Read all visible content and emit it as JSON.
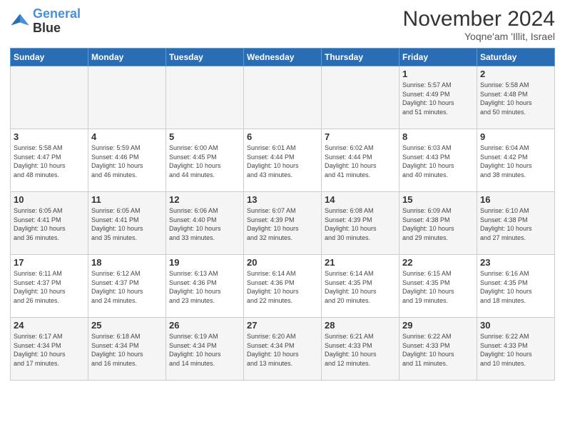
{
  "logo": {
    "line1": "General",
    "line2": "Blue"
  },
  "title": "November 2024",
  "location": "Yoqne'am 'Illit, Israel",
  "days_of_week": [
    "Sunday",
    "Monday",
    "Tuesday",
    "Wednesday",
    "Thursday",
    "Friday",
    "Saturday"
  ],
  "weeks": [
    [
      {
        "day": "",
        "info": ""
      },
      {
        "day": "",
        "info": ""
      },
      {
        "day": "",
        "info": ""
      },
      {
        "day": "",
        "info": ""
      },
      {
        "day": "",
        "info": ""
      },
      {
        "day": "1",
        "info": "Sunrise: 5:57 AM\nSunset: 4:49 PM\nDaylight: 10 hours\nand 51 minutes."
      },
      {
        "day": "2",
        "info": "Sunrise: 5:58 AM\nSunset: 4:48 PM\nDaylight: 10 hours\nand 50 minutes."
      }
    ],
    [
      {
        "day": "3",
        "info": "Sunrise: 5:58 AM\nSunset: 4:47 PM\nDaylight: 10 hours\nand 48 minutes."
      },
      {
        "day": "4",
        "info": "Sunrise: 5:59 AM\nSunset: 4:46 PM\nDaylight: 10 hours\nand 46 minutes."
      },
      {
        "day": "5",
        "info": "Sunrise: 6:00 AM\nSunset: 4:45 PM\nDaylight: 10 hours\nand 44 minutes."
      },
      {
        "day": "6",
        "info": "Sunrise: 6:01 AM\nSunset: 4:44 PM\nDaylight: 10 hours\nand 43 minutes."
      },
      {
        "day": "7",
        "info": "Sunrise: 6:02 AM\nSunset: 4:44 PM\nDaylight: 10 hours\nand 41 minutes."
      },
      {
        "day": "8",
        "info": "Sunrise: 6:03 AM\nSunset: 4:43 PM\nDaylight: 10 hours\nand 40 minutes."
      },
      {
        "day": "9",
        "info": "Sunrise: 6:04 AM\nSunset: 4:42 PM\nDaylight: 10 hours\nand 38 minutes."
      }
    ],
    [
      {
        "day": "10",
        "info": "Sunrise: 6:05 AM\nSunset: 4:41 PM\nDaylight: 10 hours\nand 36 minutes."
      },
      {
        "day": "11",
        "info": "Sunrise: 6:05 AM\nSunset: 4:41 PM\nDaylight: 10 hours\nand 35 minutes."
      },
      {
        "day": "12",
        "info": "Sunrise: 6:06 AM\nSunset: 4:40 PM\nDaylight: 10 hours\nand 33 minutes."
      },
      {
        "day": "13",
        "info": "Sunrise: 6:07 AM\nSunset: 4:39 PM\nDaylight: 10 hours\nand 32 minutes."
      },
      {
        "day": "14",
        "info": "Sunrise: 6:08 AM\nSunset: 4:39 PM\nDaylight: 10 hours\nand 30 minutes."
      },
      {
        "day": "15",
        "info": "Sunrise: 6:09 AM\nSunset: 4:38 PM\nDaylight: 10 hours\nand 29 minutes."
      },
      {
        "day": "16",
        "info": "Sunrise: 6:10 AM\nSunset: 4:38 PM\nDaylight: 10 hours\nand 27 minutes."
      }
    ],
    [
      {
        "day": "17",
        "info": "Sunrise: 6:11 AM\nSunset: 4:37 PM\nDaylight: 10 hours\nand 26 minutes."
      },
      {
        "day": "18",
        "info": "Sunrise: 6:12 AM\nSunset: 4:37 PM\nDaylight: 10 hours\nand 24 minutes."
      },
      {
        "day": "19",
        "info": "Sunrise: 6:13 AM\nSunset: 4:36 PM\nDaylight: 10 hours\nand 23 minutes."
      },
      {
        "day": "20",
        "info": "Sunrise: 6:14 AM\nSunset: 4:36 PM\nDaylight: 10 hours\nand 22 minutes."
      },
      {
        "day": "21",
        "info": "Sunrise: 6:14 AM\nSunset: 4:35 PM\nDaylight: 10 hours\nand 20 minutes."
      },
      {
        "day": "22",
        "info": "Sunrise: 6:15 AM\nSunset: 4:35 PM\nDaylight: 10 hours\nand 19 minutes."
      },
      {
        "day": "23",
        "info": "Sunrise: 6:16 AM\nSunset: 4:35 PM\nDaylight: 10 hours\nand 18 minutes."
      }
    ],
    [
      {
        "day": "24",
        "info": "Sunrise: 6:17 AM\nSunset: 4:34 PM\nDaylight: 10 hours\nand 17 minutes."
      },
      {
        "day": "25",
        "info": "Sunrise: 6:18 AM\nSunset: 4:34 PM\nDaylight: 10 hours\nand 16 minutes."
      },
      {
        "day": "26",
        "info": "Sunrise: 6:19 AM\nSunset: 4:34 PM\nDaylight: 10 hours\nand 14 minutes."
      },
      {
        "day": "27",
        "info": "Sunrise: 6:20 AM\nSunset: 4:34 PM\nDaylight: 10 hours\nand 13 minutes."
      },
      {
        "day": "28",
        "info": "Sunrise: 6:21 AM\nSunset: 4:33 PM\nDaylight: 10 hours\nand 12 minutes."
      },
      {
        "day": "29",
        "info": "Sunrise: 6:22 AM\nSunset: 4:33 PM\nDaylight: 10 hours\nand 11 minutes."
      },
      {
        "day": "30",
        "info": "Sunrise: 6:22 AM\nSunset: 4:33 PM\nDaylight: 10 hours\nand 10 minutes."
      }
    ]
  ]
}
